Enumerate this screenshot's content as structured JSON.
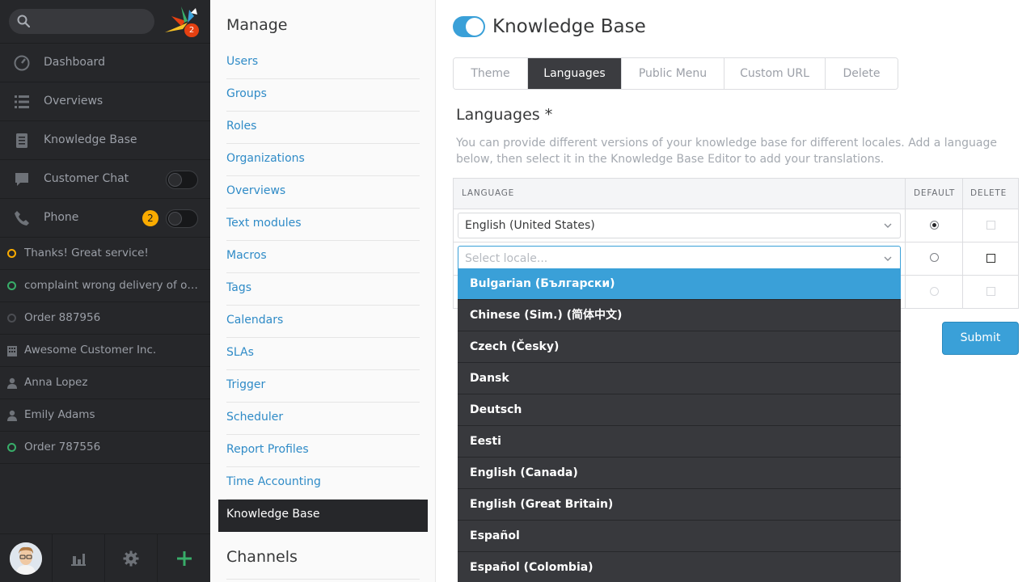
{
  "navigation": {
    "search_placeholder": "",
    "logo_badge": "2",
    "menu": [
      {
        "label": "Dashboard",
        "icon": "dashboard-icon"
      },
      {
        "label": "Overviews",
        "icon": "overviews-icon"
      },
      {
        "label": "Knowledge Base",
        "icon": "knowledge-base-icon"
      },
      {
        "label": "Customer Chat",
        "icon": "chat-icon"
      },
      {
        "label": "Phone",
        "icon": "phone-icon",
        "badge": "2"
      }
    ],
    "tasks": [
      {
        "label": "Thanks! Great service!",
        "icon": "ticket-open-icon"
      },
      {
        "label": "complaint wrong delivery of ord...",
        "icon": "ticket-open-icon"
      },
      {
        "label": "Order 887956",
        "icon": "ticket-closed-icon"
      },
      {
        "label": "Awesome Customer Inc.",
        "icon": "organization-icon"
      },
      {
        "label": "Anna Lopez",
        "icon": "user-icon"
      },
      {
        "label": "Emily Adams",
        "icon": "user-icon"
      },
      {
        "label": "Order 787556",
        "icon": "ticket-open-icon"
      }
    ],
    "colors": {
      "pending": "#faab00",
      "open": "#38ad69",
      "closed": "#4b4d52"
    }
  },
  "manage": {
    "title": "Manage",
    "links": [
      "Users",
      "Groups",
      "Roles",
      "Organizations",
      "Overviews",
      "Text modules",
      "Macros",
      "Tags",
      "Calendars",
      "SLAs",
      "Trigger",
      "Scheduler",
      "Report Profiles",
      "Time Accounting",
      "Knowledge Base"
    ],
    "active": "Knowledge Base",
    "channels_title": "Channels"
  },
  "main": {
    "title": "Knowledge Base",
    "tabs": [
      "Theme",
      "Languages",
      "Public Menu",
      "Custom URL",
      "Delete"
    ],
    "active_tab": "Languages",
    "section_title": "Languages *",
    "section_desc": "You can provide different versions of your knowledge base for different locales. Add a language below, then select it in the Knowledge Base Editor to add your translations.",
    "table": {
      "headers": {
        "language": "LANGUAGE",
        "default": "DEFAULT",
        "delete": "DELETE"
      },
      "row1_value": "English (United States)",
      "row2_placeholder": "Select locale..."
    },
    "submit_label": "Submit",
    "accent_color": "#3aa0d8"
  },
  "dropdown": {
    "options": [
      "Bulgarian (Български)",
      "Chinese (Sim.) (简体中文)",
      "Czech (Česky)",
      "Dansk",
      "Deutsch",
      "Eesti",
      "English (Canada)",
      "English (Great Britain)",
      "Español",
      "Español (Colombia)"
    ],
    "highlighted": "Bulgarian (Български)"
  }
}
